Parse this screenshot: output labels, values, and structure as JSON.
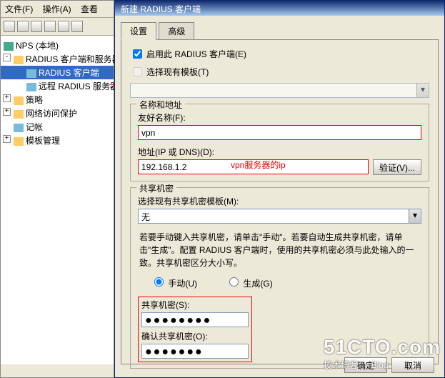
{
  "mmc": {
    "menu": {
      "file": "文件(F)",
      "action": "操作(A)",
      "view": "查看"
    },
    "root": "NPS (本地)",
    "items": [
      "RADIUS 客户端和服务器",
      "RADIUS 客户端",
      "远程 RADIUS 服务器",
      "策略",
      "网络访问保护",
      "记帐",
      "模板管理"
    ]
  },
  "dialog": {
    "title": "新建 RADIUS 客户端",
    "tabs": {
      "settings": "设置",
      "advanced": "高级"
    },
    "enable_label": "启用此 RADIUS 客户端(E)",
    "select_template_label": "选择现有模板(T)",
    "group_name": {
      "title": "名称和地址",
      "friendly_label": "友好名称(F):",
      "friendly_value": "vpn",
      "addr_label": "地址(IP 或 DNS)(D):",
      "addr_value": "192.168.1.2",
      "addr_annot": "vpn服务器的ip",
      "verify_btn": "验证(V)..."
    },
    "group_secret": {
      "title": "共享机密",
      "template_label": "选择现有共享机密模板(M):",
      "template_value": "无",
      "note": "若要手动键入共享机密，请单击\"手动\"。若要自动生成共享机密，请单击\"生成\"。配置 RADIUS 客户端时，使用的共享机密必须与此处输入的一致。共享机密区分大小写。",
      "manual": "手动(U)",
      "generate": "生成(G)",
      "secret_label": "共享机密(S):",
      "secret_value": "●●●●●●●●",
      "confirm_label": "确认共享机密(O):",
      "confirm_value": "●●●●●●●"
    },
    "ok": "确定",
    "cancel": "取消"
  },
  "watermark": {
    "big": "51CTO.com",
    "small": "技术博客 — Blog"
  }
}
